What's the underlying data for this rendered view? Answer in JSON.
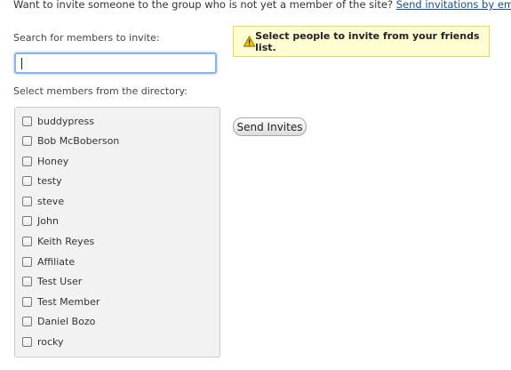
{
  "intro": {
    "text": "Want to invite someone to the group who is not yet a member of the site?",
    "link": "Send invitations by email."
  },
  "search": {
    "label": "Search for members to invite:",
    "value": "",
    "placeholder": ""
  },
  "notice": {
    "icon": "warning-icon",
    "text": "Select people to invite from your friends list."
  },
  "directory": {
    "label": "Select members from the directory:",
    "members": [
      "buddypress",
      "Bob McBoberson",
      "Honey",
      "testy",
      "steve",
      "John",
      "Keith Reyes",
      "Affiliate",
      "Test User",
      "Test Member",
      "Daniel Bozo",
      "rocky"
    ]
  },
  "send_button": {
    "label": "Send Invites"
  },
  "colors": {
    "notice_bg": "#fffdd1",
    "notice_border": "#e6db55",
    "link": "#1a4f8a",
    "input_focus": "#8db2e3"
  }
}
